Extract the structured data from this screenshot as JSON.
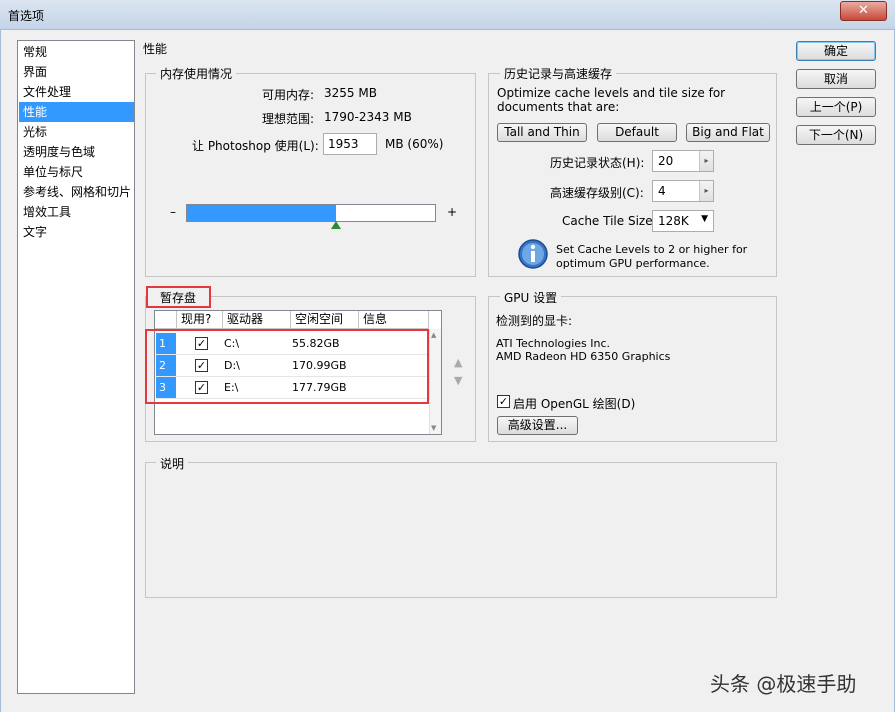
{
  "window": {
    "title": "首选项",
    "close_label": "✕"
  },
  "sidebar": {
    "items": [
      {
        "label": "常规"
      },
      {
        "label": "界面"
      },
      {
        "label": "文件处理"
      },
      {
        "label": "性能",
        "selected": true
      },
      {
        "label": "光标"
      },
      {
        "label": "透明度与色域"
      },
      {
        "label": "单位与标尺"
      },
      {
        "label": "参考线、网格和切片"
      },
      {
        "label": "增效工具"
      },
      {
        "label": "文字"
      }
    ]
  },
  "main": {
    "section_title": "性能"
  },
  "memory": {
    "group_label": "内存使用情况",
    "available_label": "可用内存:",
    "available_value": "3255 MB",
    "ideal_label": "理想范围:",
    "ideal_value": "1790-2343 MB",
    "use_label": "让 Photoshop 使用(L):",
    "use_value": "1953",
    "use_unit": "MB (60%)",
    "slider_minus": "–",
    "slider_plus": "+",
    "slider_fraction": 0.6
  },
  "history": {
    "group_label": "历史记录与高速缓存",
    "desc": "Optimize cache levels and tile size for documents that are:",
    "btn_tall": "Tall and Thin",
    "btn_default": "Default",
    "btn_big": "Big and Flat",
    "states_label": "历史记录状态(H):",
    "states_value": "20",
    "levels_label": "高速缓存级别(C):",
    "levels_value": "4",
    "tile_label": "Cache Tile Size:",
    "tile_value": "128K",
    "info_text": "Set Cache Levels to 2 or higher for optimum GPU performance.",
    "info_icon": "info-icon"
  },
  "scratch": {
    "group_label": "暂存盘",
    "columns": [
      "现用?",
      "驱动器",
      "空闲空间",
      "信息"
    ],
    "rows": [
      {
        "num": "1",
        "checked": "✓",
        "drive": "C:\\",
        "free": "55.82GB",
        "info": ""
      },
      {
        "num": "2",
        "checked": "✓",
        "drive": "D:\\",
        "free": "170.99GB",
        "info": ""
      },
      {
        "num": "3",
        "checked": "✓",
        "drive": "E:\\",
        "free": "177.79GB",
        "info": ""
      }
    ],
    "up_arrow": "▲",
    "down_arrow": "▼"
  },
  "gpu": {
    "group_label": "GPU 设置",
    "detected_label": "检测到的显卡:",
    "vendor": "ATI Technologies Inc.",
    "card": "AMD Radeon HD 6350 Graphics",
    "opengl_checked": "✓",
    "opengl_label": "启用 OpenGL 绘图(D)",
    "advanced_button": "高级设置..."
  },
  "description": {
    "group_label": "说明"
  },
  "actions": {
    "ok": "确定",
    "cancel": "取消",
    "prev": "上一个(P)",
    "next": "下一个(N)"
  },
  "watermark": "头条 @极速手助",
  "colors": {
    "selection": "#3399ff",
    "highlight_box": "#e4393c",
    "slider_fill": "#3399ff"
  }
}
